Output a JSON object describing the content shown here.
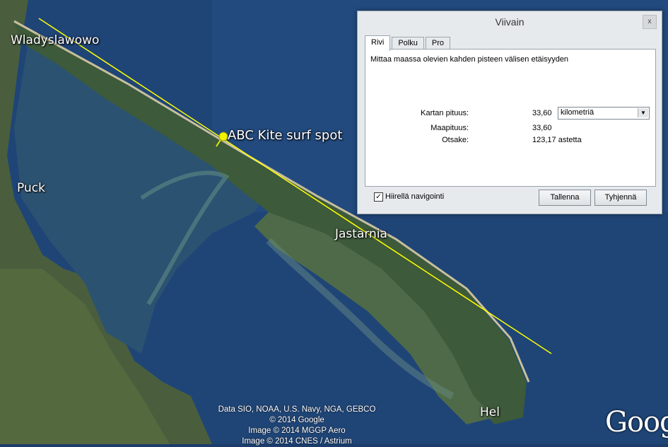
{
  "map": {
    "places": [
      "Wladyslawowo",
      "Puck",
      "Jastarnia",
      "Hel"
    ],
    "placemark": "ABC Kite surf spot",
    "attribution": [
      "Data SIO, NOAA, U.S. Navy, NGA, GEBCO",
      "© 2014 Google",
      "Image © 2014 MGGP Aero",
      "Image © 2014 CNES / Astrium"
    ],
    "logo": "Goog",
    "colors": {
      "sea": "#1f4577",
      "bay": "#2b5270",
      "land": "#4a5e3e",
      "measure_line": "#ffff00"
    }
  },
  "dialog": {
    "title": "Viivain",
    "close": "x",
    "tabs": [
      "Rivi",
      "Polku",
      "Pro"
    ],
    "description": "Mittaa maassa olevien kahden pisteen välisen etäisyyden",
    "map_length_label": "Kartan pituus:",
    "map_length_value": "33,60",
    "unit": "kilometriä",
    "ground_length_label": "Maapituus:",
    "ground_length_value": "33,60",
    "heading_label": "Otsake:",
    "heading_value": "123,17 astetta",
    "mouse_nav_label": "Hiirellä navigointi",
    "mouse_nav_checked": "✓",
    "save_label": "Tallenna",
    "clear_label": "Tyhjennä"
  }
}
